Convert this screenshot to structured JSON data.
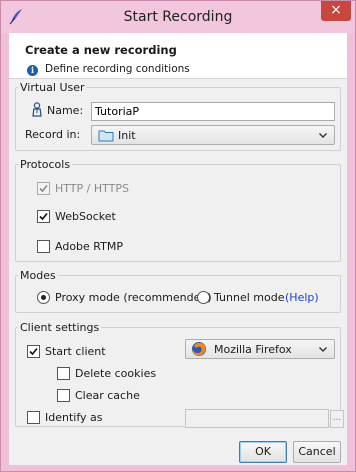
{
  "window": {
    "title": "Start Recording",
    "close_glyph": "×"
  },
  "header": {
    "title": "Create a new recording",
    "subtitle": "Define recording conditions",
    "info_glyph": "i"
  },
  "virtual_user": {
    "legend": "Virtual User",
    "name_label": "Name:",
    "name_value": "TutoriaP",
    "record_in_label": "Record in:",
    "record_in_value": "Init"
  },
  "protocols": {
    "legend": "Protocols",
    "items": [
      {
        "label": "HTTP / HTTPS",
        "checked": true,
        "disabled": true
      },
      {
        "label": "WebSocket",
        "checked": true,
        "disabled": false
      },
      {
        "label": "Adobe RTMP",
        "checked": false,
        "disabled": false
      }
    ]
  },
  "modes": {
    "legend": "Modes",
    "proxy_label": "Proxy mode (recommended)",
    "tunnel_label": "Tunnel mode",
    "help_link": "(Help)",
    "selected": "proxy"
  },
  "client_settings": {
    "legend": "Client settings",
    "start_client_label": "Start client",
    "start_client_checked": true,
    "browser_value": "Mozilla Firefox",
    "delete_cookies_label": "Delete cookies",
    "clear_cache_label": "Clear cache",
    "identify_as_label": "Identify as",
    "identify_as_value": "",
    "browse_glyph": "..."
  },
  "buttons": {
    "ok": "OK",
    "cancel": "Cancel"
  },
  "colors": {
    "frame": "#f0c0d8",
    "close": "#c7463e",
    "link": "#1f3fd1",
    "info": "#1d5fa8"
  },
  "icons": [
    "app-feather-icon",
    "close-icon",
    "info-icon",
    "user-icon",
    "folder-icon",
    "firefox-icon",
    "chevron-down-icon",
    "checkmark-icon"
  ]
}
